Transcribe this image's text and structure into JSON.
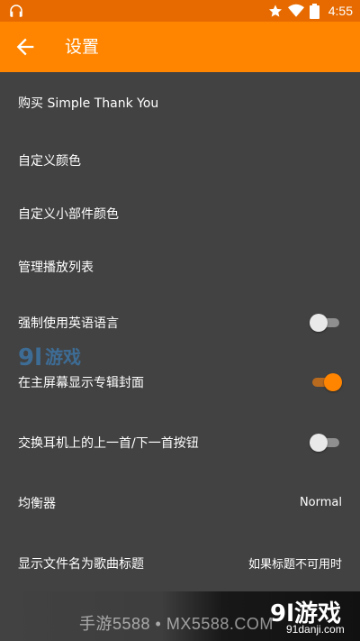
{
  "status_bar": {
    "time": "4:55",
    "icons": [
      "headphones-icon",
      "star-icon",
      "wifi-icon",
      "battery-icon"
    ]
  },
  "app_bar": {
    "title": "设置",
    "back_icon": "arrow-back-icon"
  },
  "settings": [
    {
      "label": "购买 Simple Thank You",
      "type": "item"
    },
    {
      "label": "自定义颜色",
      "type": "item"
    },
    {
      "label": "自定义小部件颜色",
      "type": "item"
    },
    {
      "label": "管理播放列表",
      "type": "item"
    },
    {
      "label": "强制使用英语语言",
      "type": "toggle",
      "checked": false
    },
    {
      "label": "在主屏幕显示专辑封面",
      "type": "toggle",
      "checked": true
    },
    {
      "label": "交换耳机上的上一首/下一首按钮",
      "type": "toggle",
      "checked": false
    },
    {
      "label": "均衡器",
      "type": "value",
      "value": "Normal"
    },
    {
      "label": "显示文件名为歌曲标题",
      "type": "value",
      "value": "如果标题不可用时"
    }
  ],
  "watermark": {
    "top_logo": "91游戏",
    "bottom_site": "手游5588 • MX5588.COM",
    "bottom_brand": "9l游戏",
    "bottom_brand_sub": "91danji.com"
  },
  "colors": {
    "app_bar": "#ff8500",
    "status_bar": "#e66a00",
    "background": "#424242",
    "accent": "#ff8500"
  }
}
